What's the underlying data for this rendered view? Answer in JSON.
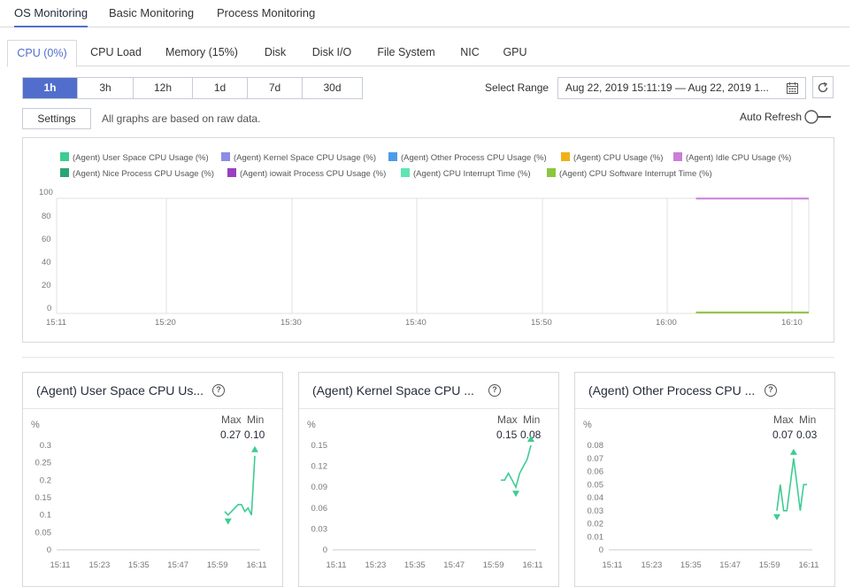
{
  "top_tabs": [
    "OS Monitoring",
    "Basic Monitoring",
    "Process Monitoring"
  ],
  "sub_tabs": [
    "CPU (0%)",
    "CPU Load",
    "Memory (15%)",
    "Disk",
    "Disk I/O",
    "File System",
    "NIC",
    "GPU"
  ],
  "range_options": [
    "1h",
    "3h",
    "12h",
    "1d",
    "7d",
    "30d"
  ],
  "select_range_label": "Select Range",
  "date_range": "Aug 22, 2019 15:11:19 — Aug 22, 2019 1...",
  "settings_label": "Settings",
  "raw_data_note": "All graphs are based on raw data.",
  "auto_refresh_label": "Auto Refresh",
  "colors": {
    "accent": "#526ecc",
    "series_green": "#3dcc93"
  },
  "main_chart": {
    "legend": [
      {
        "label": "(Agent) User Space CPU Usage (%)",
        "color": "#3dcc93"
      },
      {
        "label": "(Agent) Kernel Space CPU Usage (%)",
        "color": "#8c8ce6"
      },
      {
        "label": "(Agent) Other Process CPU Usage (%)",
        "color": "#4c9bea"
      },
      {
        "label": "(Agent) CPU Usage (%)",
        "color": "#f0b118"
      },
      {
        "label": "(Agent) Idle CPU Usage (%)",
        "color": "#c97ed9"
      },
      {
        "label": "(Agent) Nice Process CPU Usage (%)",
        "color": "#2ba474"
      },
      {
        "label": "(Agent) iowait Process CPU Usage (%)",
        "color": "#9a3fbf"
      },
      {
        "label": "(Agent) CPU Interrupt Time (%)",
        "color": "#5ee5b3"
      },
      {
        "label": "(Agent) CPU Software Interrupt Time (%)",
        "color": "#8cc63f"
      }
    ],
    "y_ticks": [
      "100",
      "80",
      "60",
      "40",
      "20",
      "0"
    ],
    "x_ticks": [
      "15:11",
      "15:20",
      "15:30",
      "15:40",
      "15:50",
      "16:00",
      "16:10"
    ]
  },
  "chart_data": [
    {
      "type": "line",
      "title": "",
      "x_range": [
        "16:02",
        "16:11"
      ],
      "ylim": [
        0,
        100
      ],
      "series": [
        {
          "name": "(Agent) Idle CPU Usage (%)",
          "values": [
            99.8,
            99.8
          ]
        },
        {
          "name": "(Agent) CPU Software Interrupt Time (%)",
          "values": [
            0.1,
            0.1
          ]
        }
      ]
    },
    {
      "type": "line",
      "title": "(Agent) User Space CPU Us...",
      "ylabel": "%",
      "max": "0.27",
      "min": "0.10",
      "y_ticks": [
        "0.3",
        "0.25",
        "0.2",
        "0.15",
        "0.1",
        "0.05",
        "0"
      ],
      "x_ticks": [
        "15:11",
        "15:23",
        "15:35",
        "15:47",
        "15:59",
        "16:11"
      ],
      "ylim": [
        0,
        0.3
      ],
      "series": [
        {
          "values": [
            0.11,
            0.1,
            0.11,
            0.12,
            0.13,
            0.13,
            0.11,
            0.12,
            0.1,
            0.27
          ]
        }
      ]
    },
    {
      "type": "line",
      "title": "(Agent) Kernel Space CPU ...",
      "ylabel": "%",
      "max": "0.15",
      "min": "0.08",
      "y_ticks": [
        "0.15",
        "0.12",
        "0.09",
        "0.06",
        "0.03",
        "0"
      ],
      "x_ticks": [
        "15:11",
        "15:23",
        "15:35",
        "15:47",
        "15:59",
        "16:11"
      ],
      "ylim": [
        0,
        0.15
      ],
      "series": [
        {
          "values": [
            0.1,
            0.1,
            0.11,
            0.1,
            0.09,
            0.11,
            0.12,
            0.13,
            0.15
          ]
        }
      ]
    },
    {
      "type": "line",
      "title": "(Agent) Other Process CPU ...",
      "ylabel": "%",
      "max": "0.07",
      "min": "0.03",
      "y_ticks": [
        "0.08",
        "0.07",
        "0.06",
        "0.05",
        "0.04",
        "0.03",
        "0.02",
        "0.01",
        "0"
      ],
      "x_ticks": [
        "15:11",
        "15:23",
        "15:35",
        "15:47",
        "15:59",
        "16:11"
      ],
      "ylim": [
        0,
        0.08
      ],
      "series": [
        {
          "values": [
            0.03,
            0.05,
            0.03,
            0.03,
            0.05,
            0.07,
            0.05,
            0.03,
            0.05,
            0.05
          ]
        }
      ]
    }
  ]
}
